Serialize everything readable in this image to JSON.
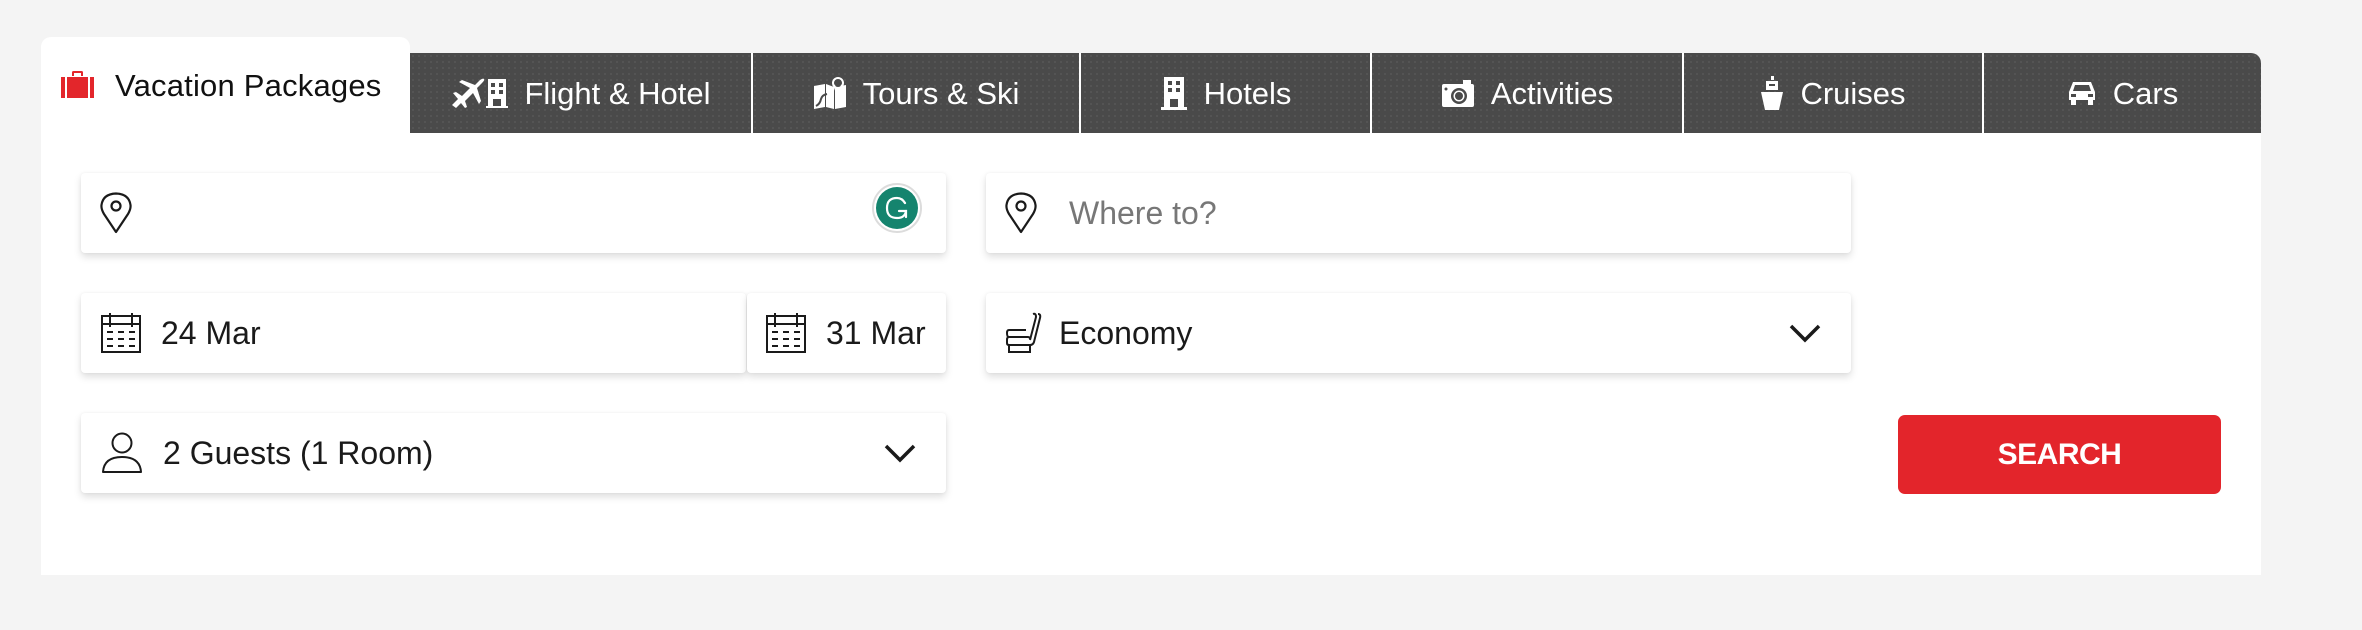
{
  "tabs": {
    "active": {
      "label": "Vacation Packages",
      "icon": "suitcase-icon"
    },
    "items": [
      {
        "label": "Flight & Hotel",
        "icon": "flight-hotel-icon"
      },
      {
        "label": "Tours & Ski",
        "icon": "map-pin-icon"
      },
      {
        "label": "Hotels",
        "icon": "hotel-icon"
      },
      {
        "label": "Activities",
        "icon": "camera-icon"
      },
      {
        "label": "Cruises",
        "icon": "ship-icon"
      },
      {
        "label": "Cars",
        "icon": "car-icon"
      }
    ]
  },
  "form": {
    "from": {
      "value": "",
      "placeholder": "",
      "icon": "location-pin-icon"
    },
    "to": {
      "value": "",
      "placeholder": "Where to?",
      "icon": "location-pin-icon"
    },
    "depart_date": {
      "value": "24 Mar",
      "icon": "calendar-icon"
    },
    "return_date": {
      "value": "31 Mar",
      "icon": "calendar-icon"
    },
    "cabin_class": {
      "value": "Economy",
      "icon": "seat-icon"
    },
    "guests": {
      "value": "2 Guests (1 Room)",
      "icon": "person-icon"
    },
    "search_label": "SEARCH"
  },
  "colors": {
    "accent": "#e3252b",
    "tabbar": "#4a4a4a",
    "grammarly": "#15846e",
    "page_bg": "#f4f4f4"
  }
}
